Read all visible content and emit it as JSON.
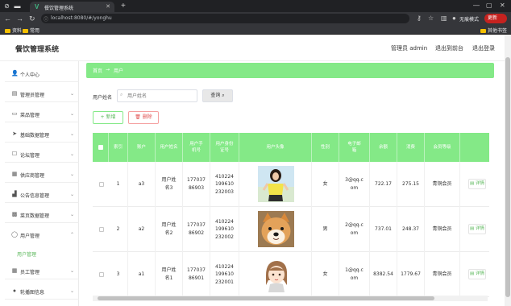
{
  "browser": {
    "tab_title": "餐饮管理系统",
    "url": "localhost:8080/#/yonghu",
    "incognito_label": "无痕模式",
    "update_label": "更新",
    "bookmarks": [
      "资料",
      "常用"
    ],
    "other_bookmarks": "其他书签"
  },
  "header": {
    "title": "餐饮管理系统",
    "admin_label": "管理员 admin",
    "exit_front": "退出到前台",
    "logout": "退出登录"
  },
  "sidebar": {
    "items": [
      {
        "label": "个人中心",
        "icon": "user-icon"
      },
      {
        "label": "管理员管理",
        "icon": "admin-icon"
      },
      {
        "label": "菜品管理",
        "icon": "chat-icon"
      },
      {
        "label": "基础数据管理",
        "icon": "send-icon"
      },
      {
        "label": "论坛管理",
        "icon": "forum-icon"
      },
      {
        "label": "供应商管理",
        "icon": "supplier-icon"
      },
      {
        "label": "公告信息管理",
        "icon": "chart-icon"
      },
      {
        "label": "菜页数据管理",
        "icon": "grid-icon"
      },
      {
        "label": "用户管理",
        "icon": "person-icon"
      },
      {
        "label": "员工管理",
        "icon": "staff-icon"
      },
      {
        "label": "轮播图信息",
        "icon": "map-pin-icon"
      }
    ],
    "active_sub": "用户管理"
  },
  "breadcrumb": {
    "home": "首页",
    "separator": "→",
    "current": "用户"
  },
  "search": {
    "label": "用户姓名",
    "placeholder": "用户姓名",
    "query_button": "查询"
  },
  "actions": {
    "add": "新增",
    "delete": "删除"
  },
  "table": {
    "headers": [
      "索引",
      "账户",
      "用户姓名",
      "用户手机号",
      "用户身份证号",
      "用户头像",
      "性别",
      "电子邮箱",
      "余额",
      "消费",
      "会员等级"
    ],
    "rows": [
      {
        "index": "1",
        "account": "a3",
        "name": "用户姓名3",
        "phone": "17703786903",
        "idcard": "410224199610232003",
        "avatar": "girl-photo",
        "gender": "女",
        "email": "3@qq.com",
        "balance": "722.17",
        "spent": "275.15",
        "level": "青铜会员",
        "action": "详情"
      },
      {
        "index": "2",
        "account": "a2",
        "name": "用户姓名2",
        "phone": "17703786902",
        "idcard": "410224199610232002",
        "avatar": "dog-photo",
        "gender": "男",
        "email": "2@qq.com",
        "balance": "737.01",
        "spent": "248.37",
        "level": "青铜会员",
        "action": "详情"
      },
      {
        "index": "3",
        "account": "a1",
        "name": "用户姓名1",
        "phone": "17703786901",
        "idcard": "410224199610232001",
        "avatar": "cartoon-girl",
        "gender": "女",
        "email": "1@qq.com",
        "balance": "8382.54",
        "spent": "1779.67",
        "level": "青铜会员",
        "action": "详情"
      }
    ]
  },
  "colors": {
    "accent": "#84e987",
    "accent_text": "#5cb85c",
    "danger": "#e05050"
  }
}
